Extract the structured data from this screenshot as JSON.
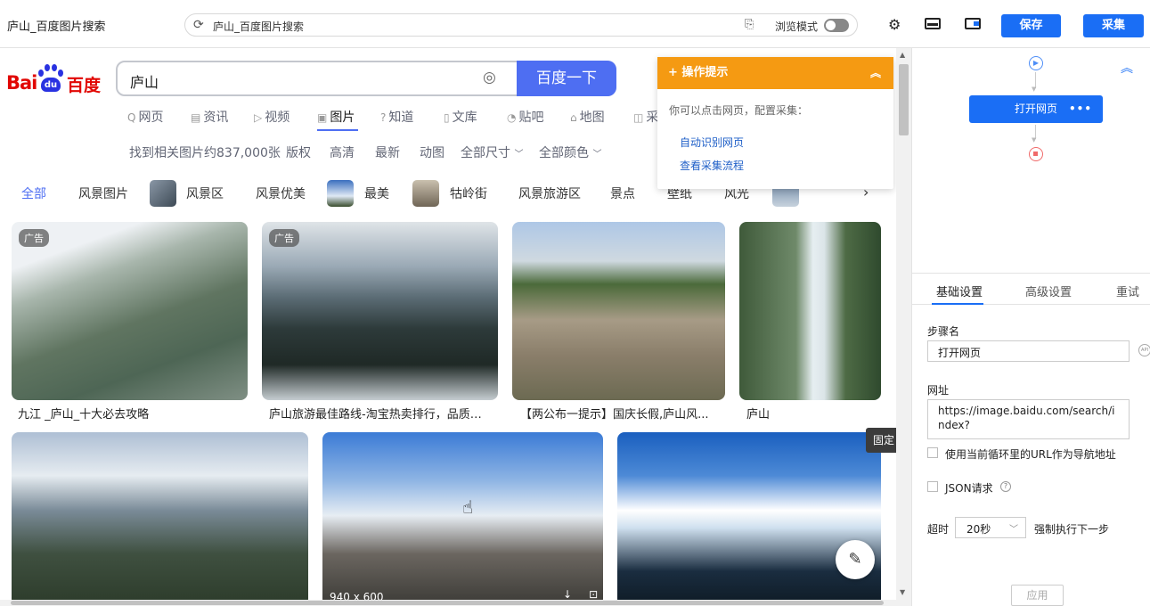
{
  "window": {
    "tab_title": "庐山_百度图片搜索"
  },
  "urlbar": {
    "text": "庐山_百度图片搜索",
    "mode_label": "浏览模式"
  },
  "toolbar": {
    "save_label": "保存",
    "collect_label": "采集"
  },
  "page": {
    "logo": {
      "text_left": "Bai",
      "text_mid": "du",
      "text_right": "百度"
    },
    "search": {
      "query": "庐山",
      "button": "百度一下"
    },
    "nav_tabs": [
      {
        "label": "网页",
        "icon": "Q"
      },
      {
        "label": "资讯",
        "icon": "▤"
      },
      {
        "label": "视频",
        "icon": "▷"
      },
      {
        "label": "图片",
        "icon": "▣"
      },
      {
        "label": "知道",
        "icon": "?"
      },
      {
        "label": "文库",
        "icon": "▯"
      },
      {
        "label": "贴吧",
        "icon": "◔"
      },
      {
        "label": "地图",
        "icon": "⌂"
      },
      {
        "label": "采",
        "icon": "◫"
      }
    ],
    "filters": {
      "count": "找到相关图片约837,000张",
      "items": [
        "版权",
        "高清",
        "最新",
        "动图",
        "全部尺寸",
        "全部颜色"
      ]
    },
    "chips": [
      "全部",
      "风景图片",
      "风景区",
      "风景优美",
      "最美",
      "牯岭街",
      "风景旅游区",
      "景点",
      "壁纸",
      "风光"
    ],
    "ad_label": "广告",
    "captions": [
      "九江 _庐山_十大必去攻略",
      "庐山旅游最佳路线-淘宝热卖排行，品质好...",
      "【两公布一提示】国庆长假,庐山风...",
      "庐山"
    ],
    "image_size": "940 x 600",
    "hint": {
      "title": "操作提示",
      "desc": "你可以点击网页，配置采集：",
      "link1": "自动识别网页",
      "link2": "查看采集流程"
    },
    "pin_label": "固定"
  },
  "panel": {
    "flow_node": "打开网页",
    "tabs": [
      "基础设置",
      "高级设置",
      "重试"
    ],
    "step_name_label": "步骤名",
    "step_name_value": "打开网页",
    "url_label": "网址",
    "url_value": "https://image.baidu.com/search/index?",
    "loop_url_label": "使用当前循环里的URL作为导航地址",
    "json_label": "JSON请求",
    "timeout_label": "超时",
    "timeout_value": "20秒",
    "force_next_label": "强制执行下一步",
    "apply_label": "应用"
  },
  "colors": {
    "accent": "#1a6ef5",
    "baidu_blue": "#4e6ef2",
    "hint_orange": "#f59a12"
  }
}
